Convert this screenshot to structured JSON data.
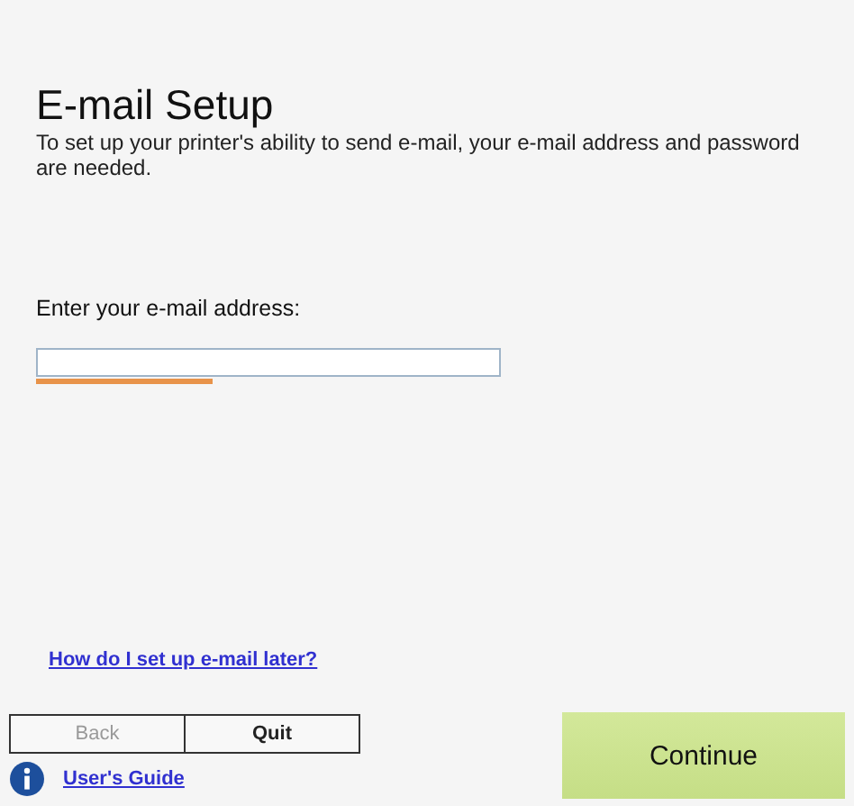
{
  "title": "E-mail Setup",
  "description": "To set up your printer's ability to send e-mail, your e-mail address and password are needed.",
  "email_field": {
    "label": "Enter your e-mail address:",
    "focused": true
  },
  "help_link": "How do I set up e-mail later?",
  "buttons": [
    {
      "label": "Back",
      "disabled": true
    },
    {
      "label": "Quit",
      "disabled": false
    }
  ],
  "guide_link": "User's Guide",
  "continue_button": "Continue"
}
